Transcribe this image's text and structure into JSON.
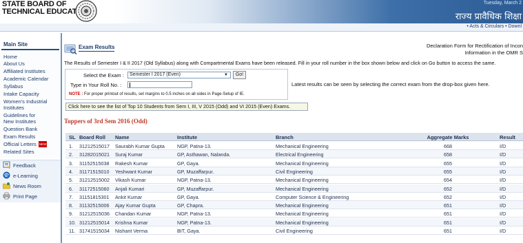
{
  "header": {
    "brand_line1": "STATE BOARD OF",
    "brand_line2": "TECHNICAL EDUCATION",
    "date_text": "Tuesday, March 2",
    "hindi_title": "राज्य प्रावैधिक शिक्षा",
    "top_links": "• Acts & Circulars • Downl"
  },
  "sidebar": {
    "title": "Main Site",
    "items": [
      {
        "label": "Home"
      },
      {
        "label": "About Us"
      },
      {
        "label": "Affiliated Institutes"
      },
      {
        "label": "Academic Calendar"
      },
      {
        "label": "Syllabus"
      },
      {
        "label": "Intake Capacity"
      },
      {
        "label": "Women's Industrial"
      },
      {
        "label": "Institutes"
      },
      {
        "label": "Guidelines for"
      },
      {
        "label": "New Institutes"
      },
      {
        "label": "Question Bank"
      },
      {
        "label": "Exam Results"
      },
      {
        "label": "Official Letters",
        "badge": "NEW"
      },
      {
        "label": "Related Sites"
      }
    ],
    "tools": [
      {
        "label": "Feedback",
        "icon": "feedback-icon"
      },
      {
        "label": "e-Learning",
        "icon": "e-learning-icon"
      },
      {
        "label": "News Room",
        "icon": "news-room-icon"
      },
      {
        "label": "Print Page",
        "icon": "print-icon"
      }
    ]
  },
  "main": {
    "section_title": "Exam Results",
    "declaration_line1": "Declaration Form for Rectification of Incon",
    "declaration_line2": "Information in the OMR S",
    "notice": "The Results of Semester I & II 2017 (Old Syllabus) along with Compartmental Exams have been released. Fill in your roll number in the box shown below and click on Go button to access the same.",
    "form": {
      "select_label": "Select the Exam :",
      "select_value": "Semester I 2017 (Even)",
      "go_label": "Go!",
      "roll_label": "Type in Your Roll No. :",
      "roll_value": "",
      "note_prefix": "NOTE :",
      "note_text": "For proper printout of results, set margins to 0.5 inches on all sides in Page-Setup of IE."
    },
    "latest_text": "Latest results can be seen by selecting the correct exam from the drop-box given here.",
    "top10_link": "Click here to see the list of Top 10 Students from Sem I, III, V 2015 (Odd) and VI 2015 (Even) Exams.",
    "toppers_title": "Toppers of 3rd Sem 2016 (Odd)"
  },
  "table": {
    "headers": {
      "sl": "SL",
      "roll": "Board Roll",
      "name": "Name",
      "institute": "Institute",
      "branch": "Branch",
      "marks": "Aggregate Marks",
      "result": "Result"
    },
    "rows": [
      {
        "sl": "1.",
        "roll": "31212515017",
        "name": "Saurabh Kumar Gupta",
        "institute": "NGP, Patna-13.",
        "branch": "Mechanical Engineering",
        "marks": "668",
        "result": "I/D"
      },
      {
        "sl": "2.",
        "roll": "31282015021",
        "name": "Suraj Kumar",
        "institute": "GP, Asthawan, Nalanda.",
        "branch": "Electrical Engineering",
        "marks": "658",
        "result": "I/D"
      },
      {
        "sl": "3.",
        "roll": "31152515038",
        "name": "Rakesh Kumar",
        "institute": "GP, Gaya.",
        "branch": "Mechanical Engineering",
        "marks": "655",
        "result": "I/D"
      },
      {
        "sl": "4.",
        "roll": "31171515010",
        "name": "Yeshwant Kumar",
        "institute": "GP, Muzaffarpur.",
        "branch": "Civil Engineering",
        "marks": "655",
        "result": "I/D"
      },
      {
        "sl": "5.",
        "roll": "31212515002",
        "name": "Vikash Kumar",
        "institute": "NGP, Patna-13.",
        "branch": "Mechanical Engineering",
        "marks": "654",
        "result": "I/D"
      },
      {
        "sl": "6.",
        "roll": "31172515060",
        "name": "Anjali Kumari",
        "institute": "GP, Muzaffarpur.",
        "branch": "Mechanical Engineering",
        "marks": "652",
        "result": "I/D"
      },
      {
        "sl": "7.",
        "roll": "31151815301",
        "name": "Ankit Kumar",
        "institute": "GP, Gaya.",
        "branch": "Computer Science & Engineering",
        "marks": "652",
        "result": "I/D"
      },
      {
        "sl": "8.",
        "roll": "31132515006",
        "name": "Ajay Kumar Gupta",
        "institute": "GP, Chapra.",
        "branch": "Mechanical Engineering",
        "marks": "651",
        "result": "I/D"
      },
      {
        "sl": "9.",
        "roll": "31212515036",
        "name": "Chandan Kumar",
        "institute": "NGP, Patna-13.",
        "branch": "Mechanical Engineering",
        "marks": "651",
        "result": "I/D"
      },
      {
        "sl": "10.",
        "roll": "31212515014",
        "name": "Krishna Kumar",
        "institute": "NGP, Patna-13.",
        "branch": "Mechanical Engineering",
        "marks": "651",
        "result": "I/D"
      },
      {
        "sl": "11.",
        "roll": "31741515034",
        "name": "Nishant Verma",
        "institute": "BIT, Gaya.",
        "branch": "Civil Engineering",
        "marks": "651",
        "result": "I/D"
      }
    ]
  }
}
